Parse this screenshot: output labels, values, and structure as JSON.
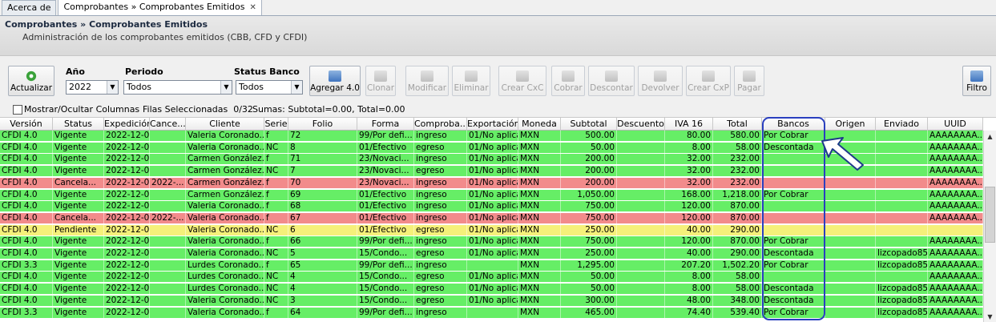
{
  "tabs": [
    {
      "label": "Acerca de",
      "active": false
    },
    {
      "label": "Comprobantes » Comprobantes Emitidos",
      "active": true,
      "close": "✕"
    }
  ],
  "header": {
    "title": "Comprobantes » Comprobantes Emitidos",
    "subtitle": "Administración de los comprobantes emitidos (CBB, CFD y CFDI)"
  },
  "toolbar": {
    "refresh_label": "Actualizar",
    "year_label": "Año",
    "year_value": "2022",
    "period_label": "Periodo",
    "period_value": "Todos",
    "bank_status_label": "Status Banco",
    "bank_status_value": "Todos",
    "buttons": [
      {
        "label": "Agregar 4.0",
        "enabled": true
      },
      {
        "label": "Clonar",
        "enabled": false
      },
      {
        "label": "Modificar",
        "enabled": false
      },
      {
        "label": "Eliminar",
        "enabled": false
      },
      {
        "label": "Crear CxC",
        "enabled": false
      },
      {
        "label": "Cobrar",
        "enabled": false
      },
      {
        "label": "Descontar",
        "enabled": false
      },
      {
        "label": "Devolver",
        "enabled": false
      },
      {
        "label": "Crear CxP",
        "enabled": false
      },
      {
        "label": "Pagar",
        "enabled": false
      }
    ],
    "filter_label": "Filtro"
  },
  "infobar": {
    "toggle_columns": "Mostrar/Ocultar Columnas",
    "selected": "Filas Seleccionadas  0/32",
    "sums": "Sumas: Subtotal=0.00, Total=0.00"
  },
  "columns": [
    "Versión",
    "Status",
    "Expedición",
    "Cance...",
    "Cliente",
    "Serie",
    "Folio",
    "Forma",
    "Comproba...",
    "Exportación",
    "Moneda",
    "Subtotal",
    "Descuento",
    "IVA 16",
    "Total",
    "Bancos",
    "Origen",
    "Enviado",
    "UUID"
  ],
  "rows": [
    {
      "color": "green",
      "v": [
        "CFDI 4.0",
        "Vigente",
        "2022-12-0...",
        "",
        "Valeria Coronado...",
        "f",
        "72",
        "99/Por defi...",
        "ingreso",
        "01/No aplica",
        "MXN",
        "500.00",
        "",
        "80.00",
        "580.00",
        "Por Cobrar",
        "",
        "",
        "AAAAAAAA..."
      ]
    },
    {
      "color": "green",
      "v": [
        "CFDI 4.0",
        "Vigente",
        "2022-12-0...",
        "",
        "Valeria Coronado...",
        "NC",
        "8",
        "01/Efectivo",
        "egreso",
        "01/No aplica",
        "MXN",
        "50.00",
        "",
        "8.00",
        "58.00",
        "Descontada",
        "",
        "",
        "AAAAAAAA..."
      ]
    },
    {
      "color": "green",
      "v": [
        "CFDI 4.0",
        "Vigente",
        "2022-12-0...",
        "",
        "Carmen González...",
        "f",
        "71",
        "23/Novaci...",
        "ingreso",
        "01/No aplica",
        "MXN",
        "200.00",
        "",
        "32.00",
        "232.00",
        "",
        "",
        "",
        "AAAAAAAA..."
      ]
    },
    {
      "color": "green",
      "v": [
        "CFDI 4.0",
        "Vigente",
        "2022-12-0...",
        "",
        "Carmen González...",
        "NC",
        "7",
        "23/Novaci...",
        "egreso",
        "01/No aplica",
        "MXN",
        "200.00",
        "",
        "32.00",
        "232.00",
        "",
        "",
        "",
        "AAAAAAAA..."
      ]
    },
    {
      "color": "red",
      "v": [
        "CFDI 4.0",
        "Cancela...",
        "2022-12-0...",
        "2022-...",
        "Carmen González...",
        "f",
        "70",
        "23/Novaci...",
        "ingreso",
        "01/No aplica",
        "MXN",
        "200.00",
        "",
        "32.00",
        "232.00",
        "",
        "",
        "",
        "AAAAAAAA..."
      ]
    },
    {
      "color": "green",
      "v": [
        "CFDI 4.0",
        "Vigente",
        "2022-12-0...",
        "",
        "Carmen González...",
        "f",
        "69",
        "01/Efectivo",
        "ingreso",
        "01/No aplica",
        "MXN",
        "1,050.00",
        "",
        "168.00",
        "1,218.00",
        "Por Cobrar",
        "",
        "",
        "AAAAAAAA..."
      ]
    },
    {
      "color": "green",
      "v": [
        "CFDI 4.0",
        "Vigente",
        "2022-12-0...",
        "",
        "Valeria Coronado...",
        "f",
        "68",
        "01/Efectivo",
        "ingreso",
        "01/No aplica",
        "MXN",
        "750.00",
        "",
        "120.00",
        "870.00",
        "",
        "",
        "",
        "AAAAAAAA..."
      ]
    },
    {
      "color": "red",
      "v": [
        "CFDI 4.0",
        "Cancela...",
        "2022-12-0...",
        "2022-...",
        "Valeria Coronado...",
        "f",
        "67",
        "01/Efectivo",
        "ingreso",
        "01/No aplica",
        "MXN",
        "750.00",
        "",
        "120.00",
        "870.00",
        "",
        "",
        "",
        "AAAAAAAA..."
      ]
    },
    {
      "color": "yellow",
      "v": [
        "CFDI 4.0",
        "Pendiente",
        "2022-12-0...",
        "",
        "Valeria Coronado...",
        "NC",
        "6",
        "01/Efectivo",
        "egreso",
        "01/No aplica",
        "MXN",
        "250.00",
        "",
        "40.00",
        "290.00",
        "",
        "",
        "",
        ""
      ]
    },
    {
      "color": "green",
      "v": [
        "CFDI 4.0",
        "Vigente",
        "2022-12-0...",
        "",
        "Valeria Coronado...",
        "f",
        "66",
        "99/Por defi...",
        "ingreso",
        "01/No aplica",
        "MXN",
        "750.00",
        "",
        "120.00",
        "870.00",
        "Por Cobrar",
        "",
        "",
        "AAAAAAAA..."
      ]
    },
    {
      "color": "green",
      "v": [
        "CFDI 4.0",
        "Vigente",
        "2022-12-0...",
        "",
        "Valeria Coronado...",
        "NC",
        "5",
        "15/Condo...",
        "egreso",
        "01/No aplica",
        "MXN",
        "250.00",
        "",
        "40.00",
        "290.00",
        "Descontada",
        "",
        "lizcopado85...",
        "AAAAAAAA..."
      ]
    },
    {
      "color": "green",
      "v": [
        "CFDI 3.3",
        "Vigente",
        "2022-12-0...",
        "",
        "Lurdes Coronado...",
        "f",
        "65",
        "99/Por defi...",
        "ingreso",
        "",
        "MXN",
        "1,295.00",
        "",
        "207.20",
        "1,502.20",
        "Por Cobrar",
        "",
        "lizcopado85...",
        "AAAAAAAA..."
      ]
    },
    {
      "color": "green",
      "v": [
        "CFDI 4.0",
        "Vigente",
        "2022-12-0...",
        "",
        "Lurdes Coronado...",
        "NC",
        "4",
        "15/Condo...",
        "egreso",
        "01/No aplica",
        "MXN",
        "50.00",
        "",
        "8.00",
        "58.00",
        "",
        "",
        "",
        "AAAAAAAA..."
      ]
    },
    {
      "color": "green",
      "v": [
        "CFDI 4.0",
        "Vigente",
        "2022-12-0...",
        "",
        "Lurdes Coronado...",
        "NC",
        "4",
        "15/Condo...",
        "egreso",
        "01/No aplica",
        "MXN",
        "50.00",
        "",
        "8.00",
        "58.00",
        "Descontada",
        "",
        "lizcopado85...",
        "AAAAAAAA..."
      ]
    },
    {
      "color": "green",
      "v": [
        "CFDI 4.0",
        "Vigente",
        "2022-12-0...",
        "",
        "Valeria Coronado...",
        "NC",
        "3",
        "15/Condo...",
        "egreso",
        "01/No aplica",
        "MXN",
        "300.00",
        "",
        "48.00",
        "348.00",
        "Descontada",
        "",
        "lizcopado85...",
        "AAAAAAAA..."
      ]
    },
    {
      "color": "green",
      "v": [
        "CFDI 3.3",
        "Vigente",
        "2022-12-0...",
        "",
        "Valeria Coronado...",
        "f",
        "64",
        "99/Por defi...",
        "ingreso",
        "",
        "MXN",
        "465.00",
        "",
        "74.40",
        "539.40",
        "Por Cobrar",
        "",
        "lizcopado85...",
        "AAAAAAAA..."
      ]
    }
  ]
}
